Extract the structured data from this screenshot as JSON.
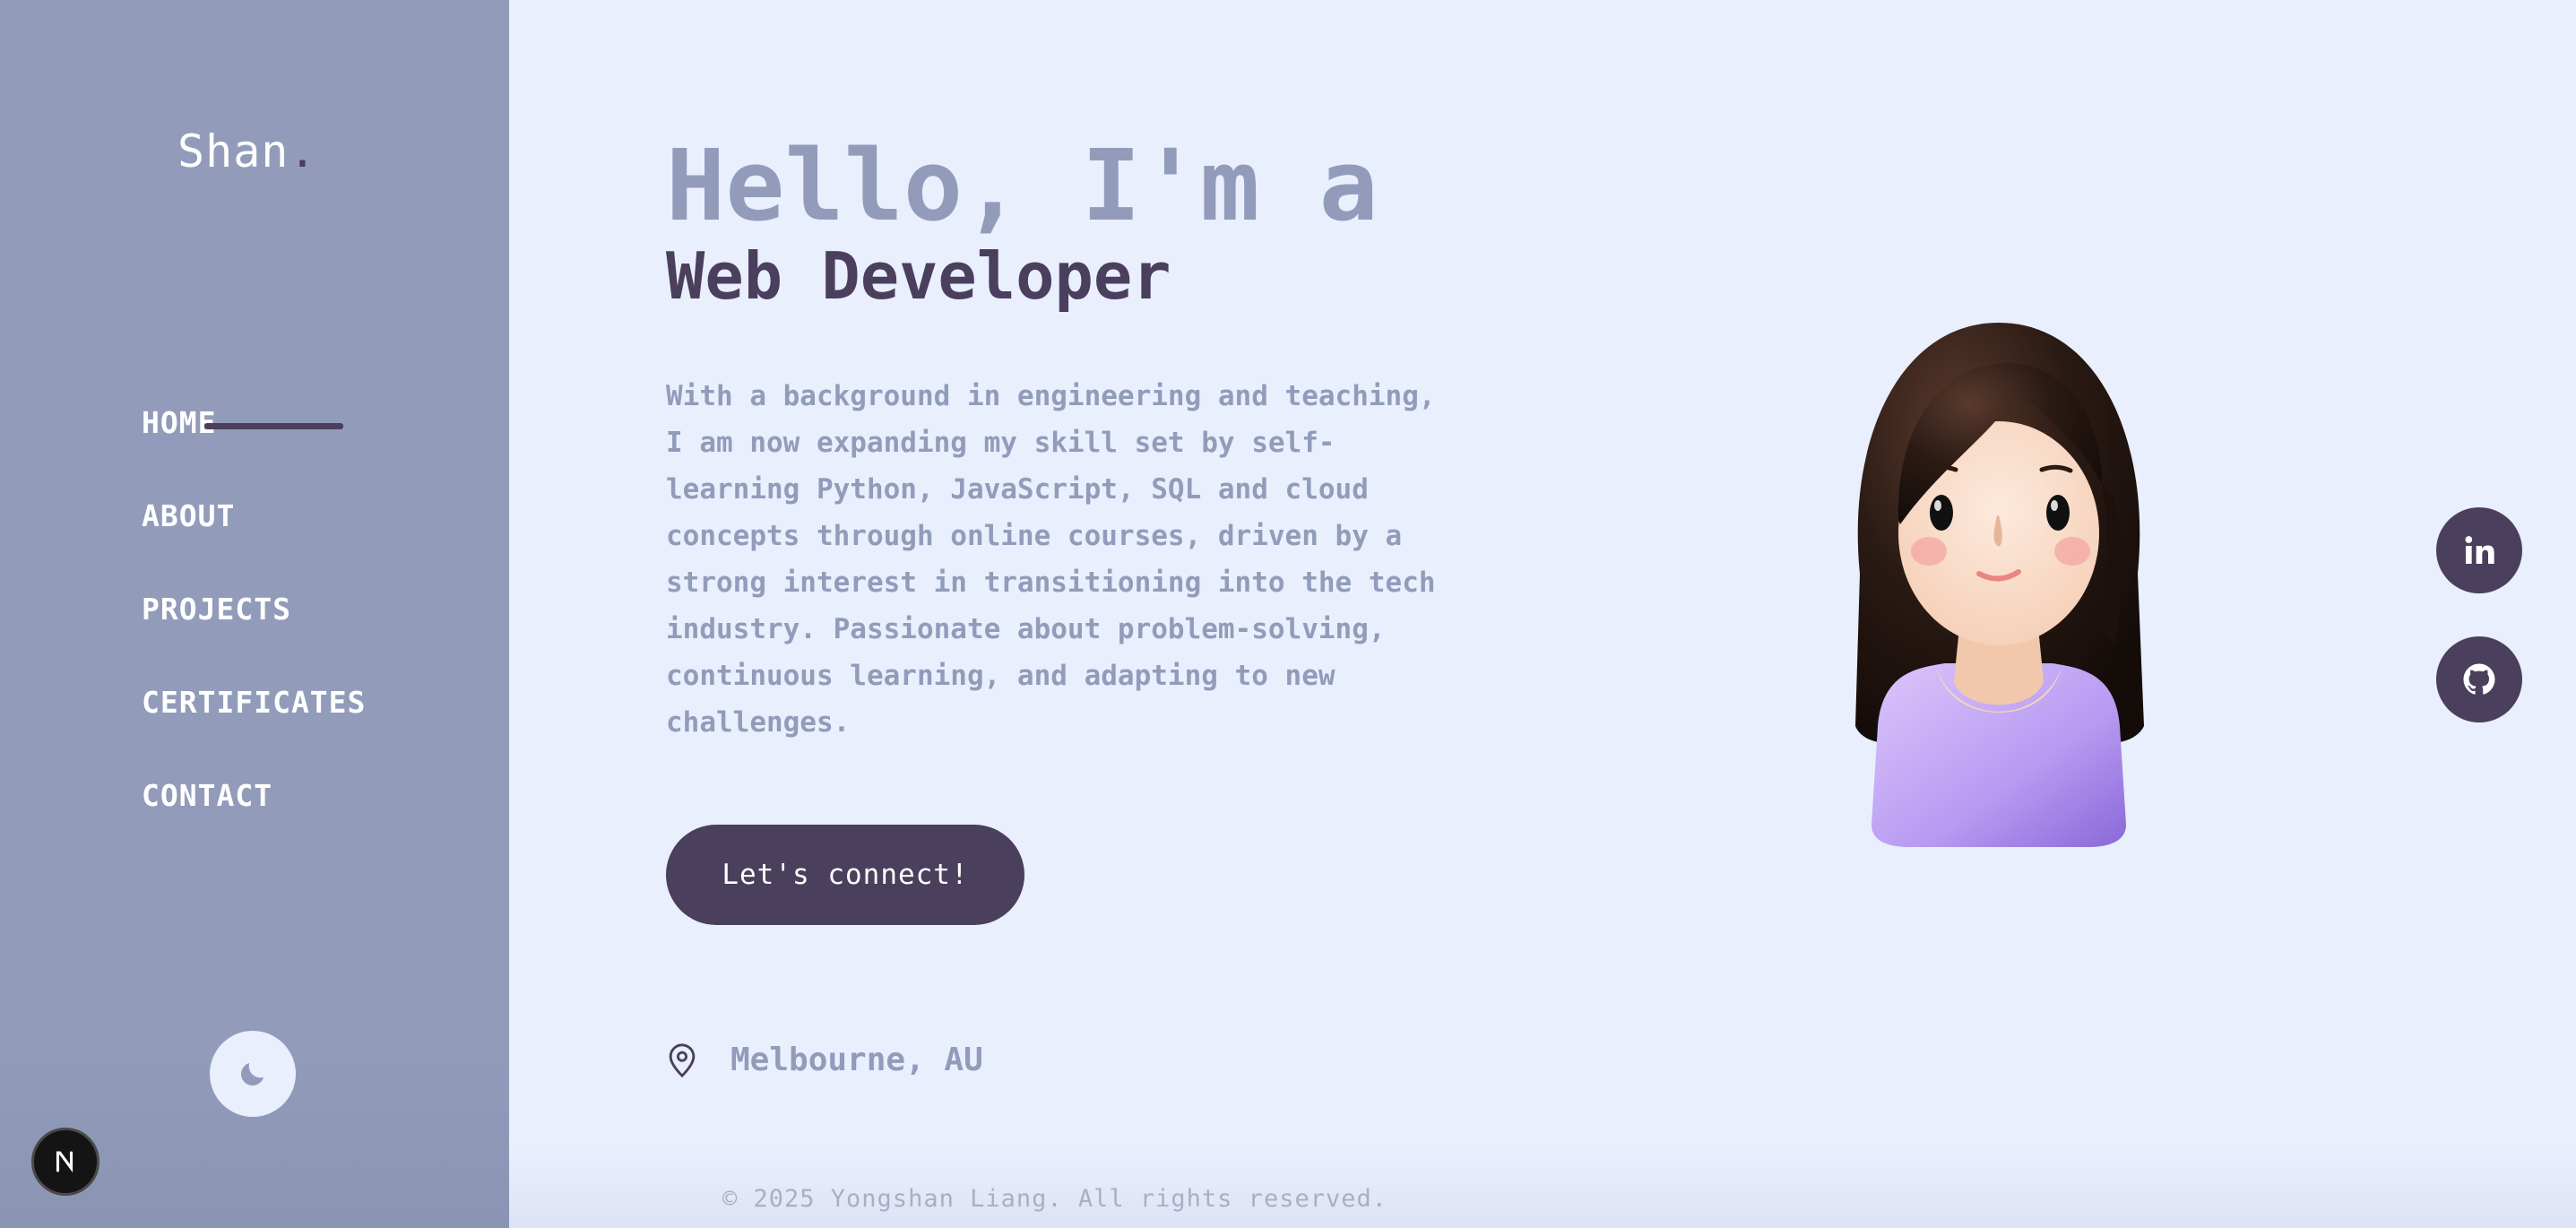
{
  "sidebar": {
    "logo_text": "Shan",
    "logo_dot": ".",
    "nav": [
      {
        "label": "HOME",
        "active": true
      },
      {
        "label": "ABOUT"
      },
      {
        "label": "PROJECTS"
      },
      {
        "label": "CERTIFICATES"
      },
      {
        "label": "CONTACT"
      }
    ],
    "theme_toggle_icon": "moon-icon",
    "badge_letter": "N"
  },
  "hero": {
    "greeting": "Hello, I'm a",
    "role": "Web Developer",
    "bio": "With a background in engineering and teaching, I am now expanding my skill set by self-learning Python, JavaScript, SQL and cloud concepts through online courses, driven by a strong interest in transitioning into the tech industry. Passionate about problem-solving, continuous learning, and adapting to new challenges.",
    "cta_label": "Let's connect!",
    "location": "Melbourne, AU"
  },
  "social": {
    "linkedin_icon": "linkedin-icon",
    "github_icon": "github-icon"
  },
  "footer": {
    "text": "© 2025 Yongshan Liang. All rights reserved."
  },
  "colors": {
    "sidebar_bg": "#929cba",
    "main_bg": "#e9effd",
    "accent_dark": "#4a3f5c",
    "muted_text": "#929cba",
    "white": "#ffffff"
  }
}
